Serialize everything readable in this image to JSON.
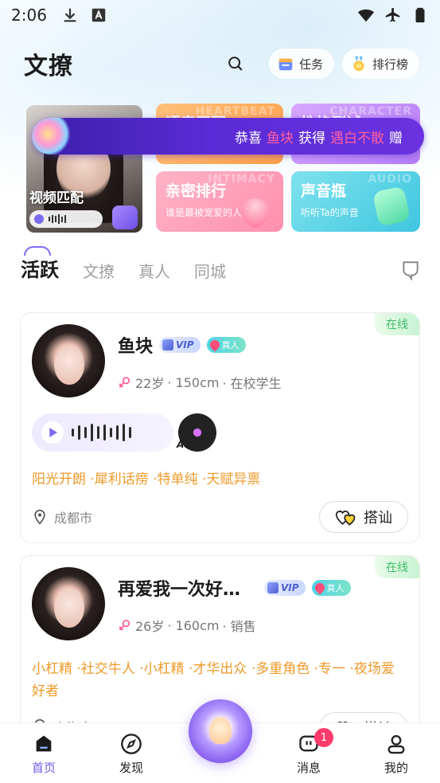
{
  "status_bar": {
    "time": "2:06",
    "left_icons": [
      "download-icon",
      "font-a-icon"
    ],
    "right_icons": [
      "wifi-icon",
      "airplane-mode-icon",
      "battery-icon"
    ]
  },
  "header": {
    "logo": "文撩",
    "tasks_label": "任务",
    "ranking_label": "排行榜"
  },
  "banners": {
    "video_match": {
      "title": "视频匹配",
      "tag": "Audio"
    },
    "marquee": {
      "prefix": "恭喜",
      "user": "鱼块",
      "verb": "获得",
      "item": "遇白不散",
      "suffix": "赠"
    },
    "cards": [
      {
        "title": "语音匹配",
        "ghost": "HEARTBEAT",
        "color": "#ffb064"
      },
      {
        "title": "性格测试",
        "ghost": "CHARACTER",
        "color": "#c490fb"
      },
      {
        "title": "亲密排行",
        "subtitle": "谁是最被宠爱的人",
        "ghost": "INTIMACY",
        "color": "#ffa2ba"
      },
      {
        "title": "声音瓶",
        "subtitle": "听听Ta的声音",
        "ghost": "AUDIO",
        "color": "#5fd4e7"
      }
    ]
  },
  "tabs": [
    {
      "label": "活跃",
      "active": true
    },
    {
      "label": "文撩",
      "active": false
    },
    {
      "label": "真人",
      "active": false
    },
    {
      "label": "同城",
      "active": false
    }
  ],
  "users": [
    {
      "name": "鱼块",
      "online": "在线",
      "vip": "VIP",
      "real": "真人",
      "age": "22岁",
      "height": "· 150cm",
      "job": "· 在校学生",
      "voice_tag": "Audio",
      "tags": "阳光开朗 ·犀利话痨 ·特单纯 ·天赋异禀",
      "location": "成都市",
      "chat_label": "搭讪"
    },
    {
      "name": "再爱我一次好…",
      "online": "在线",
      "vip": "VIP",
      "real": "真人",
      "age": "26岁",
      "height": "· 160cm",
      "job": "· 销售",
      "tags": "小杠精 ·社交牛人 ·小杠精 ·才华出众 ·多重角色 ·专一 ·夜场爱好者",
      "location": "上海市",
      "chat_label": "搭讪"
    }
  ],
  "bottom_nav": [
    {
      "label": "首页",
      "icon": "home-icon",
      "active": true
    },
    {
      "label": "发现",
      "icon": "compass-icon",
      "active": false
    },
    {
      "label": "",
      "icon": "lamp-orb-icon",
      "active": false
    },
    {
      "label": "消息",
      "icon": "message-icon",
      "active": false,
      "badge": "1"
    },
    {
      "label": "我的",
      "icon": "profile-icon",
      "active": false
    }
  ],
  "colors": {
    "accent": "#6c5ce7",
    "tag_orange": "#ef9a2a",
    "online_green": "#3dbb6a",
    "marquee_highlight": "#ff5fa0"
  }
}
